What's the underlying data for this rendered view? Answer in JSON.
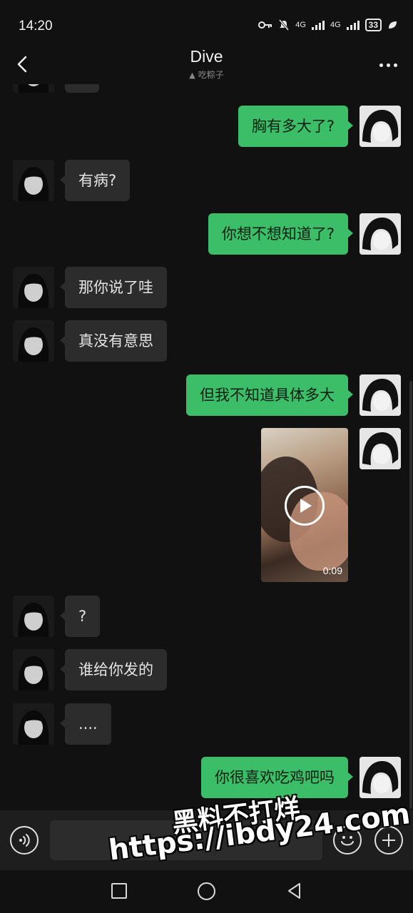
{
  "status_bar": {
    "time": "14:20",
    "network1": "4G",
    "network2": "4G",
    "battery": "33"
  },
  "header": {
    "title": "Dive",
    "subtitle": "吃粽子",
    "back_icon": "chevron-left-icon",
    "more_icon": "more-dots-icon"
  },
  "messages": [
    {
      "side": "out",
      "text": "胸有多大了?"
    },
    {
      "side": "in",
      "text": "有病?"
    },
    {
      "side": "out",
      "text": "你想不想知道了?"
    },
    {
      "side": "in",
      "text": "那你说了哇"
    },
    {
      "side": "in",
      "text": "真没有意思"
    },
    {
      "side": "out",
      "text": "但我不知道具体多大"
    },
    {
      "side": "out",
      "type": "video",
      "duration": "0:09"
    },
    {
      "side": "in",
      "text": "?"
    },
    {
      "side": "in",
      "text": "谁给你发的"
    },
    {
      "side": "in",
      "text": "...."
    },
    {
      "side": "out",
      "text": "你很喜欢吃鸡吧吗"
    }
  ],
  "input_bar": {
    "placeholder": "",
    "voice_icon": "voice-icon",
    "emoji_icon": "emoji-icon",
    "plus_icon": "plus-icon"
  },
  "watermark": {
    "line1": "黑料不打烊",
    "line2": "https://ibdy24.com"
  },
  "colors": {
    "background": "#111111",
    "outgoing_bubble": "#3cbd67",
    "incoming_bubble": "#2c2c2c"
  }
}
